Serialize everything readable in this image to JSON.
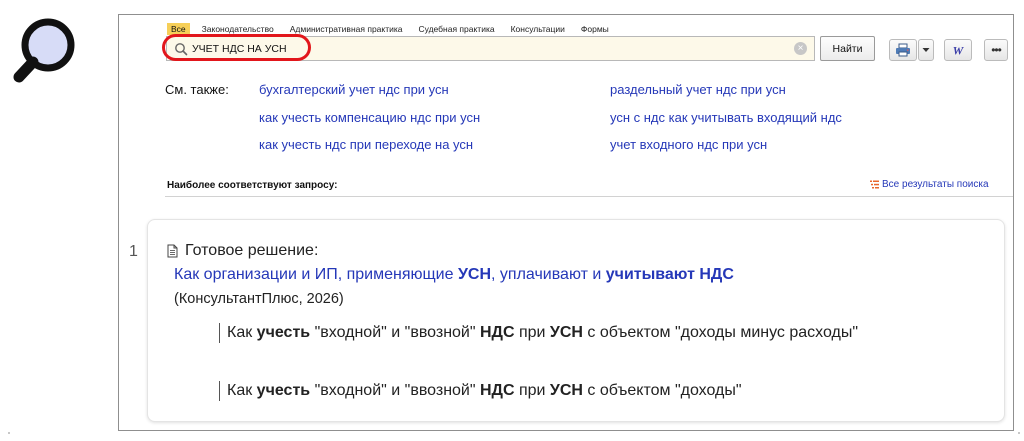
{
  "filter_tabs": [
    {
      "label": "Все",
      "active": true
    },
    {
      "label": "Законодательство",
      "active": false
    },
    {
      "label": "Административная практика",
      "active": false
    },
    {
      "label": "Судебная практика",
      "active": false
    },
    {
      "label": "Консультации",
      "active": false
    },
    {
      "label": "Формы",
      "active": false
    }
  ],
  "search": {
    "value": "УЧЕТ НДС НА УСН",
    "clear_glyph": "×",
    "button_label": "Найти"
  },
  "toolbar": {
    "word_label": "W",
    "more_label": "•••"
  },
  "see_also": {
    "label": "См. также:",
    "links": [
      "бухгалтерский учет ндс при усн",
      "как учесть компенсацию ндс при усн",
      "как учесть ндс при переходе на усн",
      "раздельный учет ндс при усн",
      "усн с ндс как учитывать входящий ндс",
      "учет входного ндс при усн"
    ]
  },
  "results_header": {
    "title": "Наиболее соответствуют запросу:",
    "all_results": "Все результаты поиска"
  },
  "results": [
    {
      "number": "1",
      "type": "Готовое решение:",
      "title_parts": [
        {
          "text": "Как организации и ИП, применяющие ",
          "bold": false
        },
        {
          "text": "УСН",
          "bold": true
        },
        {
          "text": ", уплачивают и ",
          "bold": false
        },
        {
          "text": "учитывают",
          "bold": true
        },
        {
          "text": " ",
          "bold": false
        },
        {
          "text": "НДС",
          "bold": true
        }
      ],
      "source": "(КонсультантПлюс, 2026)",
      "snippets": [
        [
          {
            "text": "Как ",
            "bold": false
          },
          {
            "text": "учесть",
            "bold": true
          },
          {
            "text": " \"входной\" и \"ввозной\" ",
            "bold": false
          },
          {
            "text": "НДС",
            "bold": true
          },
          {
            "text": " при ",
            "bold": false
          },
          {
            "text": "УСН",
            "bold": true
          },
          {
            "text": " с объектом \"доходы минус расходы\"",
            "bold": false
          }
        ],
        [
          {
            "text": "Как ",
            "bold": false
          },
          {
            "text": "учесть",
            "bold": true
          },
          {
            "text": " \"входной\" и \"ввозной\" ",
            "bold": false
          },
          {
            "text": "НДС",
            "bold": true
          },
          {
            "text": " при ",
            "bold": false
          },
          {
            "text": "УСН",
            "bold": true
          },
          {
            "text": " с объектом \"доходы\"",
            "bold": false
          }
        ]
      ]
    }
  ],
  "colors": {
    "link": "#2538b8",
    "active_tab": "#f6cf58",
    "highlight": "#e2161b",
    "search_bg": "#fdf9e9"
  }
}
